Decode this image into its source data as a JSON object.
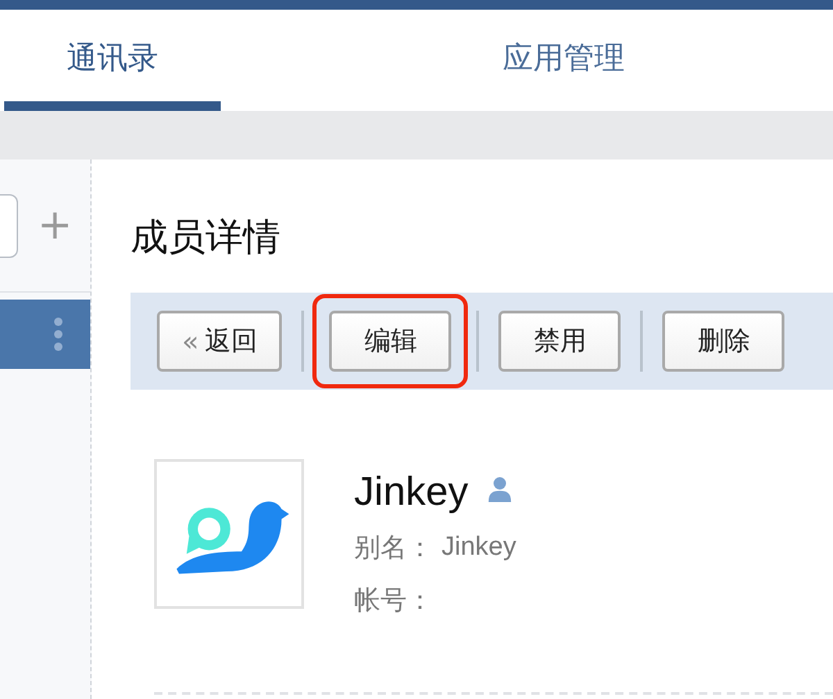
{
  "tabs": [
    {
      "label": "通讯录",
      "selected": true
    },
    {
      "label": "应用管理",
      "selected": false
    }
  ],
  "sidebar": {
    "add_button": "+",
    "items": [
      {
        "selected": true
      }
    ]
  },
  "detail": {
    "title": "成员详情",
    "toolbar": [
      {
        "kind": "back",
        "label": "返回",
        "icon": "«",
        "highlighted": false
      },
      {
        "kind": "plain",
        "label": "编辑",
        "highlighted": true
      },
      {
        "kind": "plain",
        "label": "禁用",
        "highlighted": false
      },
      {
        "kind": "plain",
        "label": "删除",
        "highlighted": false
      }
    ],
    "member": {
      "name": "Jinkey",
      "fields": [
        {
          "label": "别名：",
          "value": "Jinkey"
        },
        {
          "label": "帐号："
        }
      ]
    }
  }
}
